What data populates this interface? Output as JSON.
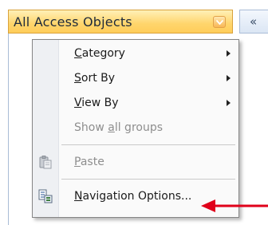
{
  "nav_pane": {
    "header_title": "All Access Objects",
    "shutter_label": "«"
  },
  "context_menu": {
    "items": [
      {
        "label_prefix": "",
        "label_underline": "C",
        "label_suffix": "ategory",
        "has_submenu": true,
        "disabled": false
      },
      {
        "label_prefix": "",
        "label_underline": "S",
        "label_suffix": "ort By",
        "has_submenu": true,
        "disabled": false
      },
      {
        "label_prefix": "",
        "label_underline": "V",
        "label_suffix": "iew By",
        "has_submenu": true,
        "disabled": false
      },
      {
        "label_prefix": "Show ",
        "label_underline": "a",
        "label_suffix": "ll groups",
        "has_submenu": false,
        "disabled": true
      },
      {
        "label_prefix": "",
        "label_underline": "P",
        "label_suffix": "aste",
        "has_submenu": false,
        "disabled": true,
        "icon": "paste-icon"
      },
      {
        "label_prefix": "",
        "label_underline": "N",
        "label_suffix": "avigation Options...",
        "has_submenu": false,
        "disabled": false,
        "icon": "navigation-options-icon"
      }
    ]
  },
  "colors": {
    "header_gradient_top": "#fff0b8",
    "header_gradient_bottom": "#ffcd5a",
    "annotation_arrow": "#e0001a"
  }
}
